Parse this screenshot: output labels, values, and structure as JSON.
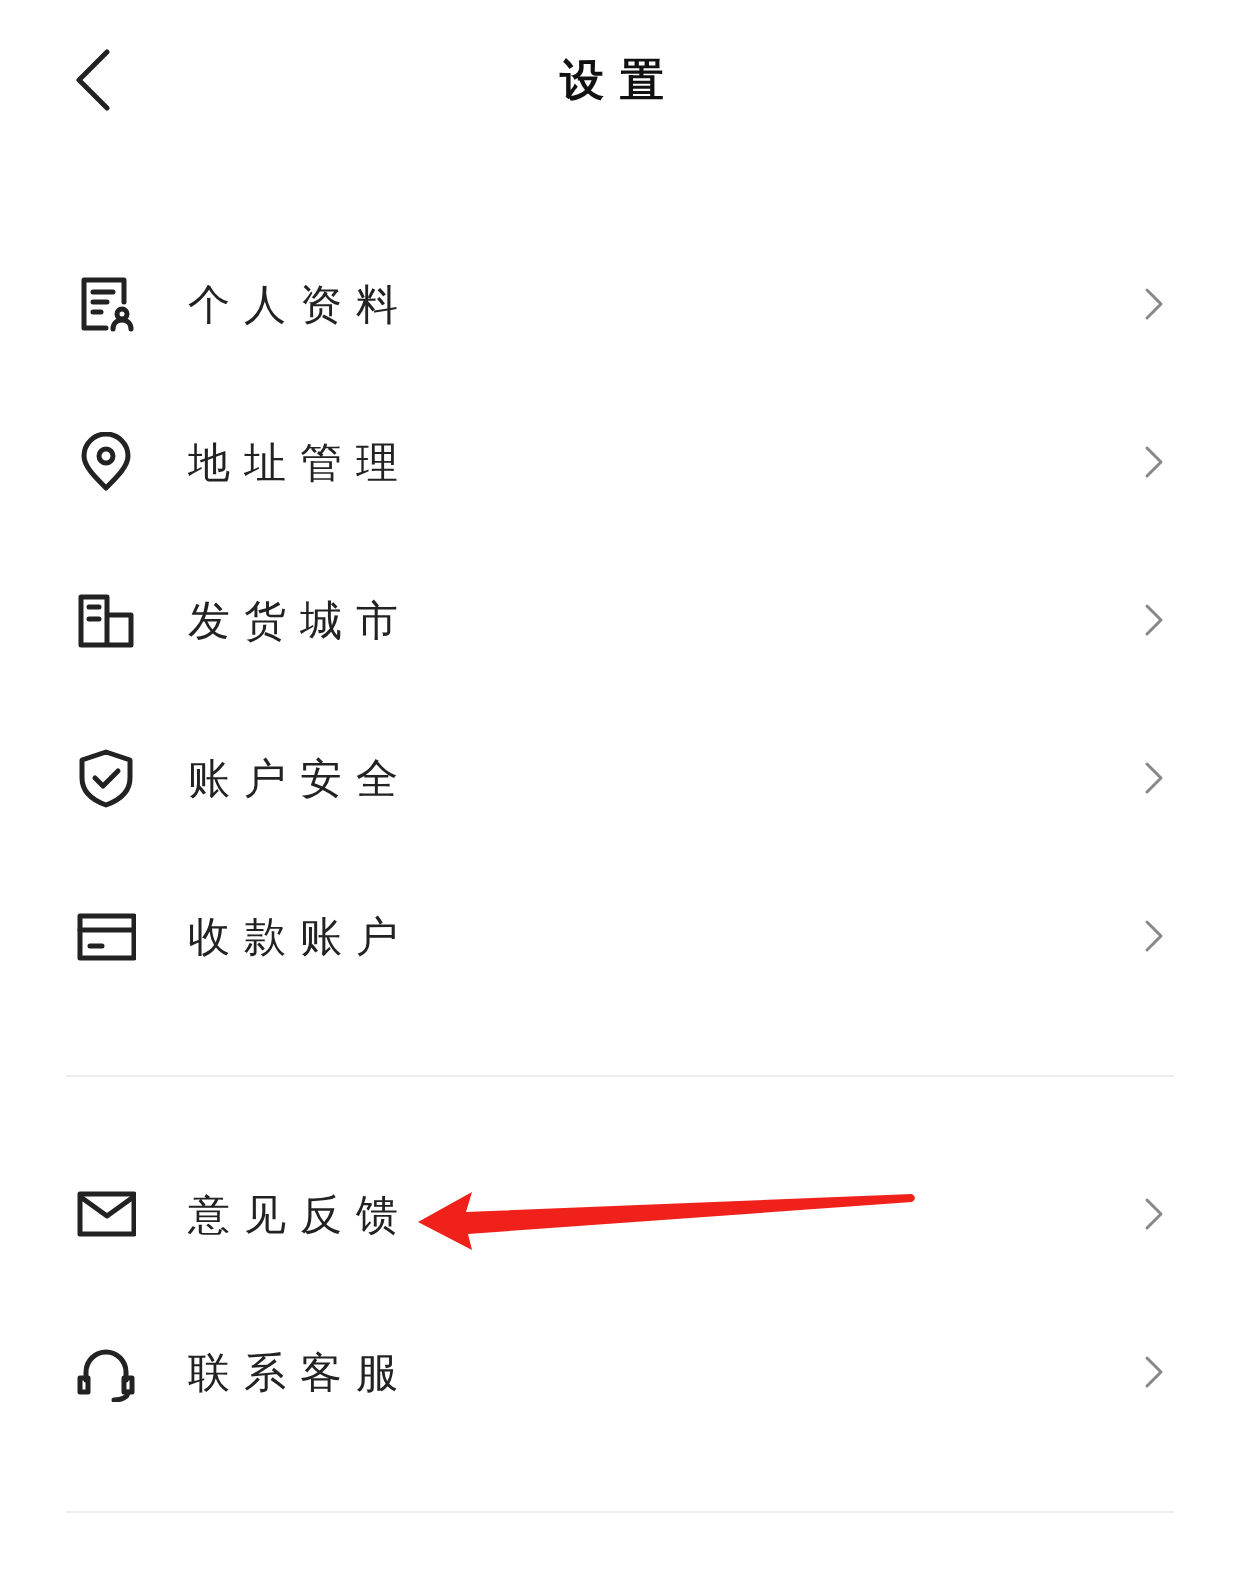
{
  "header": {
    "title": "设置"
  },
  "sections": [
    {
      "items": [
        {
          "kind": "profile",
          "label": "个人资料"
        },
        {
          "kind": "location",
          "label": "地址管理"
        },
        {
          "kind": "building",
          "label": "发货城市"
        },
        {
          "kind": "shield",
          "label": "账户安全"
        },
        {
          "kind": "card",
          "label": "收款账户"
        }
      ]
    },
    {
      "items": [
        {
          "kind": "mail",
          "label": "意见反馈"
        },
        {
          "kind": "headset",
          "label": "联系客服"
        }
      ]
    }
  ]
}
